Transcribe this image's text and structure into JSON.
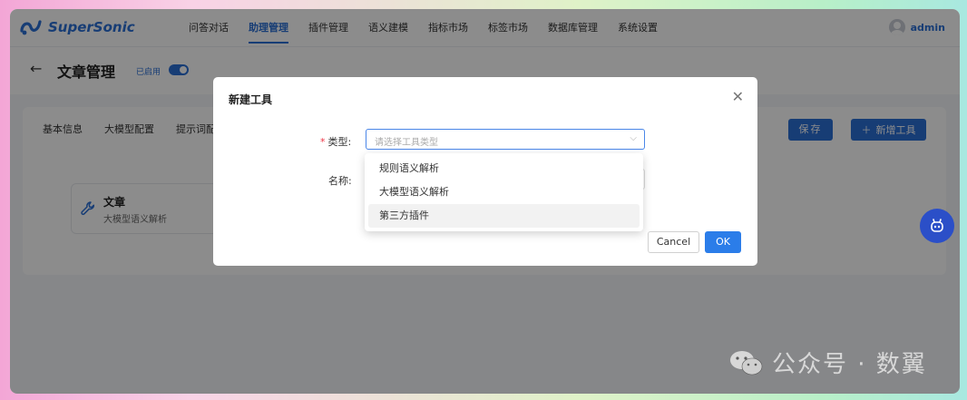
{
  "header": {
    "brand": "SuperSonic",
    "nav": [
      "问答对话",
      "助理管理",
      "插件管理",
      "语义建模",
      "指标市场",
      "标签市场",
      "数据库管理",
      "系统设置"
    ],
    "active_index": 1,
    "username": "admin"
  },
  "page": {
    "back_icon": "←",
    "title": "文章管理",
    "status_label": "已启用",
    "enabled": true
  },
  "content": {
    "tabs": [
      "基本信息",
      "大模型配置",
      "提示词配置"
    ],
    "save_label": "保存",
    "add_label": "新增工具",
    "tool_card": {
      "name": "文章",
      "description": "大模型语义解析"
    }
  },
  "modal": {
    "title": "新建工具",
    "type_label": "类型:",
    "type_placeholder": "请选择工具类型",
    "name_label": "名称:",
    "options": [
      "规则语义解析",
      "大模型语义解析",
      "第三方插件"
    ],
    "hovered_option": 2,
    "cancel_label": "Cancel",
    "ok_label": "OK"
  },
  "watermark": {
    "text": "公众号 · 数翼"
  },
  "colors": {
    "primary": "#2b6fd6",
    "float_button": "#2b4fc8"
  }
}
